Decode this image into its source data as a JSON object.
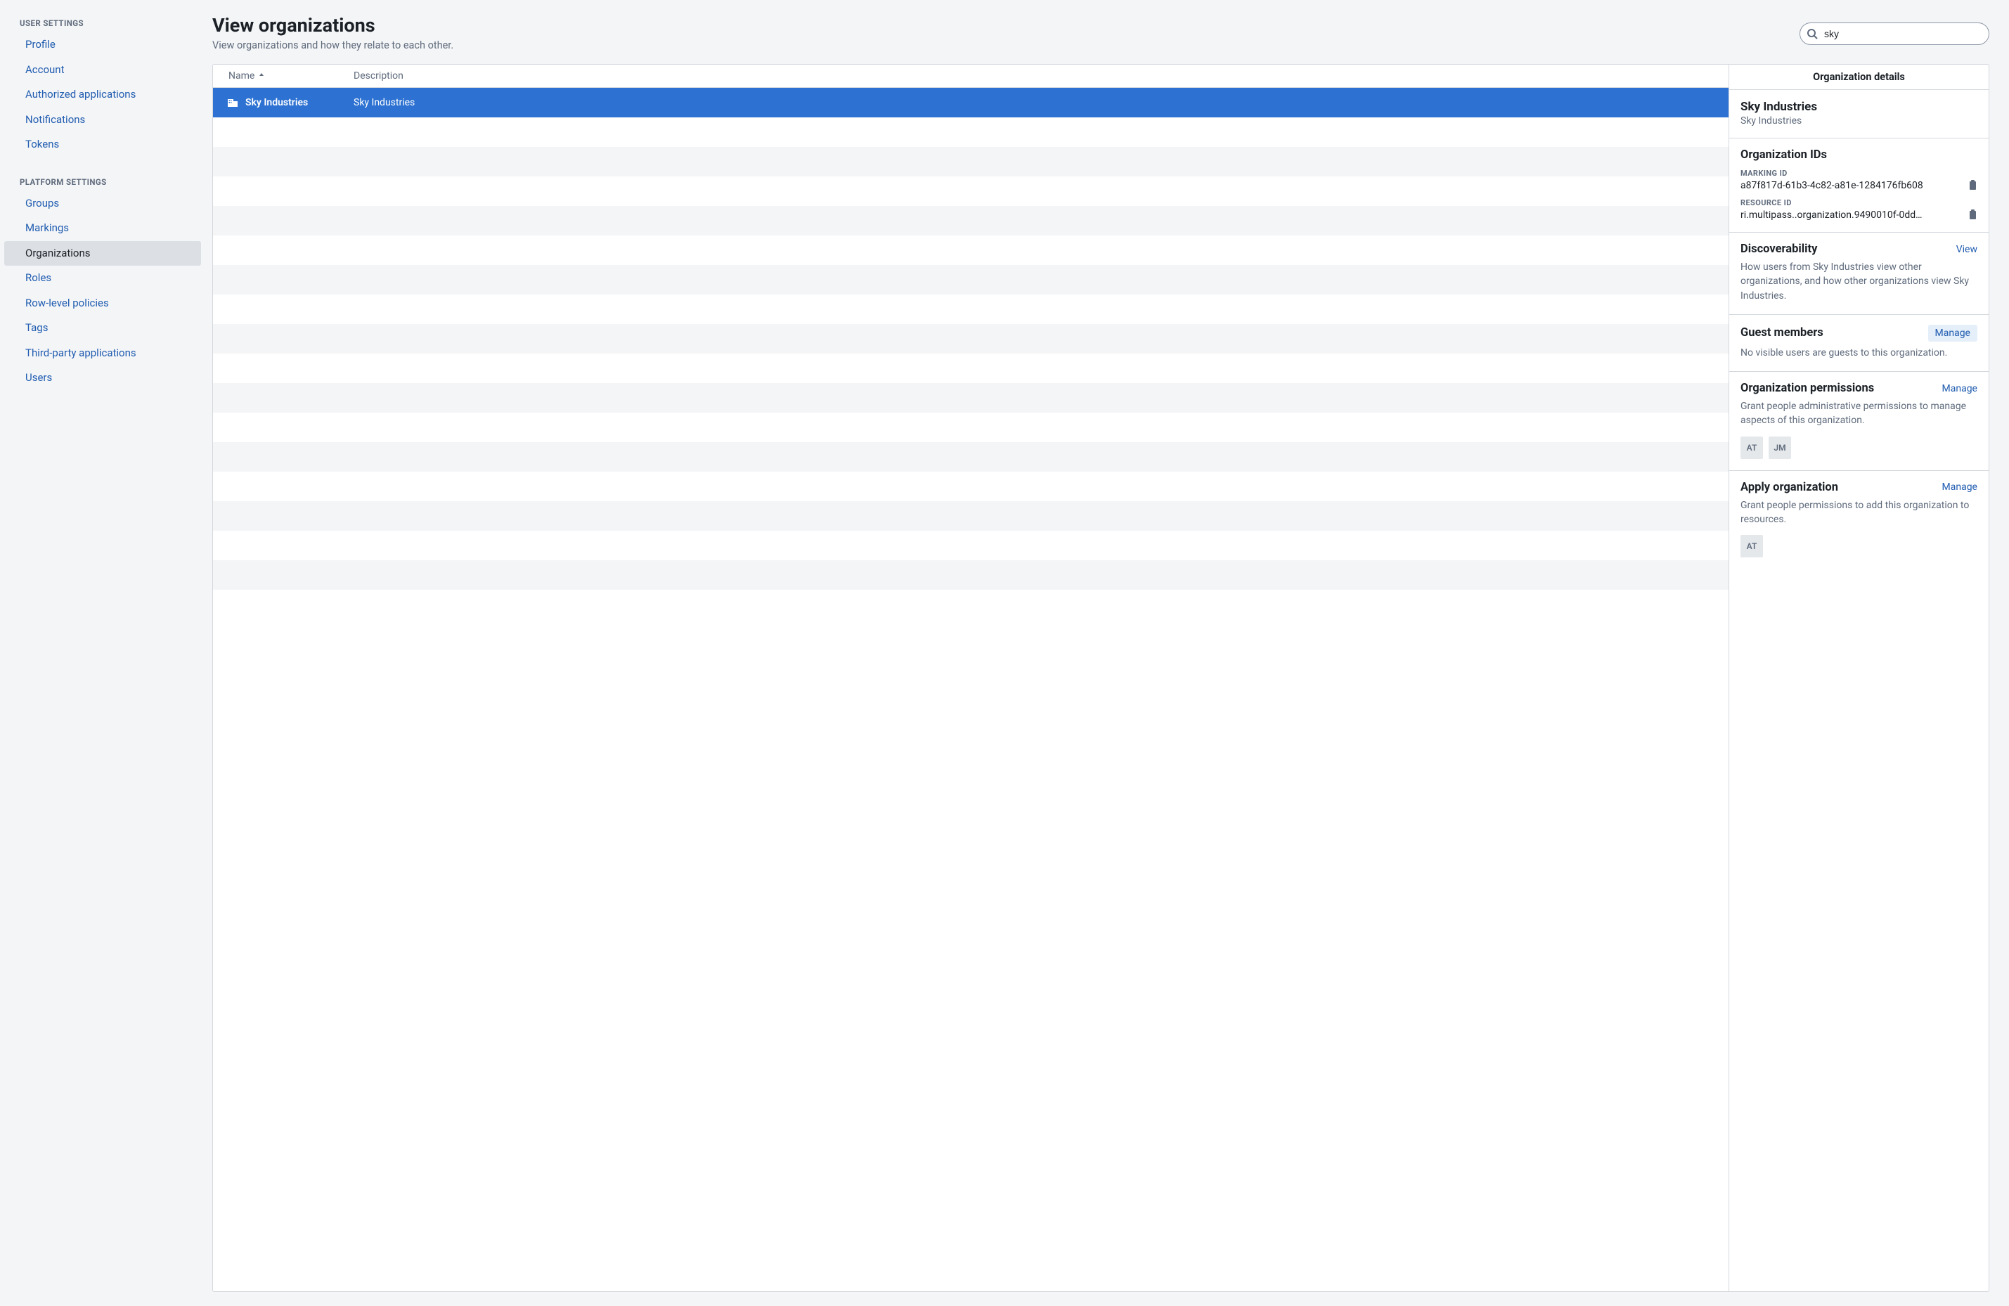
{
  "sidebar": {
    "sections": [
      {
        "title": "USER SETTINGS",
        "items": [
          {
            "label": "Profile",
            "key": "profile"
          },
          {
            "label": "Account",
            "key": "account"
          },
          {
            "label": "Authorized applications",
            "key": "authorized-applications"
          },
          {
            "label": "Notifications",
            "key": "notifications"
          },
          {
            "label": "Tokens",
            "key": "tokens"
          }
        ]
      },
      {
        "title": "PLATFORM SETTINGS",
        "items": [
          {
            "label": "Groups",
            "key": "groups"
          },
          {
            "label": "Markings",
            "key": "markings"
          },
          {
            "label": "Organizations",
            "key": "organizations",
            "active": true
          },
          {
            "label": "Roles",
            "key": "roles"
          },
          {
            "label": "Row-level policies",
            "key": "row-level-policies"
          },
          {
            "label": "Tags",
            "key": "tags"
          },
          {
            "label": "Third-party applications",
            "key": "third-party-applications"
          },
          {
            "label": "Users",
            "key": "users"
          }
        ]
      }
    ]
  },
  "page": {
    "title": "View organizations",
    "subtitle": "View organizations and how they relate to each other."
  },
  "search": {
    "value": "sky"
  },
  "table": {
    "columns": {
      "name": "Name",
      "description": "Description"
    },
    "rows": [
      {
        "name": "Sky Industries",
        "description": "Sky Industries",
        "selected": true
      }
    ],
    "empty_row_count": 16
  },
  "details": {
    "header": "Organization details",
    "org": {
      "name": "Sky Industries",
      "description": "Sky Industries"
    },
    "ids": {
      "title": "Organization IDs",
      "marking_label": "MARKING ID",
      "marking_value": "a87f817d-61b3-4c82-a81e-1284176fb608",
      "resource_label": "RESOURCE ID",
      "resource_value": "ri.multipass..organization.9490010f-0dd…"
    },
    "discoverability": {
      "title": "Discoverability",
      "action": "View",
      "body": "How users from Sky Industries view other organizations, and how other organizations view Sky Industries."
    },
    "guests": {
      "title": "Guest members",
      "action": "Manage",
      "body": "No visible users are guests to this organization."
    },
    "permissions": {
      "title": "Organization permissions",
      "action": "Manage",
      "body": "Grant people administrative permissions to manage aspects of this organization.",
      "avatars": [
        "AT",
        "JM"
      ]
    },
    "apply": {
      "title": "Apply organization",
      "action": "Manage",
      "body": "Grant people permissions to add this organization to resources.",
      "avatars": [
        "AT"
      ]
    }
  }
}
